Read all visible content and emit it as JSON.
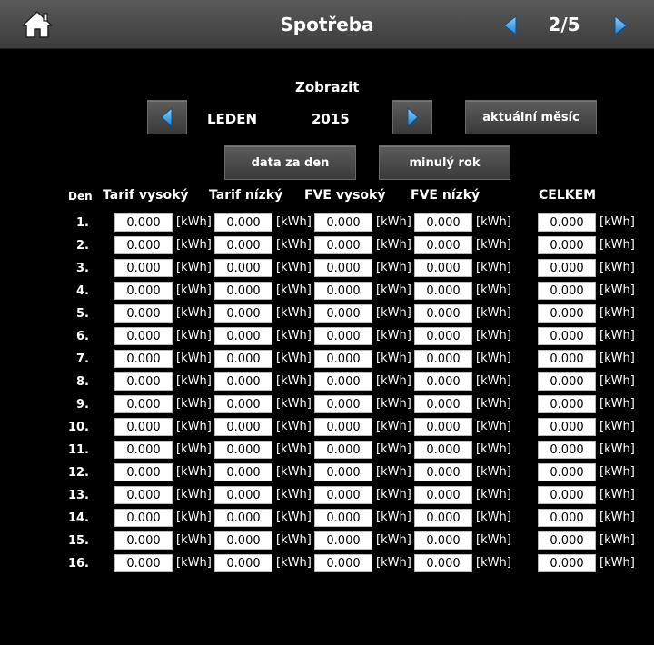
{
  "header": {
    "title": "Spotřeba",
    "page": "2/5"
  },
  "zobrazit": {
    "label": "Zobrazit",
    "month": "LEDEN",
    "year": "2015",
    "current_month_button": "aktuální měsíc",
    "day_data_button": "data za den",
    "last_year_button": "minulý rok"
  },
  "table": {
    "columns": [
      "Den",
      "Tarif vysoký",
      "Tarif nízký",
      "FVE vysoký",
      "FVE nízký",
      "CELKEM"
    ],
    "unit": "[kWh]",
    "rows": [
      {
        "day": "1.",
        "tarif_vysoky": "0.000",
        "tarif_nizky": "0.000",
        "fve_vysoky": "0.000",
        "fve_nizky": "0.000",
        "celkem": "0.000"
      },
      {
        "day": "2.",
        "tarif_vysoky": "0.000",
        "tarif_nizky": "0.000",
        "fve_vysoky": "0.000",
        "fve_nizky": "0.000",
        "celkem": "0.000"
      },
      {
        "day": "3.",
        "tarif_vysoky": "0.000",
        "tarif_nizky": "0.000",
        "fve_vysoky": "0.000",
        "fve_nizky": "0.000",
        "celkem": "0.000"
      },
      {
        "day": "4.",
        "tarif_vysoky": "0.000",
        "tarif_nizky": "0.000",
        "fve_vysoky": "0.000",
        "fve_nizky": "0.000",
        "celkem": "0.000"
      },
      {
        "day": "5.",
        "tarif_vysoky": "0.000",
        "tarif_nizky": "0.000",
        "fve_vysoky": "0.000",
        "fve_nizky": "0.000",
        "celkem": "0.000"
      },
      {
        "day": "6.",
        "tarif_vysoky": "0.000",
        "tarif_nizky": "0.000",
        "fve_vysoky": "0.000",
        "fve_nizky": "0.000",
        "celkem": "0.000"
      },
      {
        "day": "7.",
        "tarif_vysoky": "0.000",
        "tarif_nizky": "0.000",
        "fve_vysoky": "0.000",
        "fve_nizky": "0.000",
        "celkem": "0.000"
      },
      {
        "day": "8.",
        "tarif_vysoky": "0.000",
        "tarif_nizky": "0.000",
        "fve_vysoky": "0.000",
        "fve_nizky": "0.000",
        "celkem": "0.000"
      },
      {
        "day": "9.",
        "tarif_vysoky": "0.000",
        "tarif_nizky": "0.000",
        "fve_vysoky": "0.000",
        "fve_nizky": "0.000",
        "celkem": "0.000"
      },
      {
        "day": "10.",
        "tarif_vysoky": "0.000",
        "tarif_nizky": "0.000",
        "fve_vysoky": "0.000",
        "fve_nizky": "0.000",
        "celkem": "0.000"
      },
      {
        "day": "11.",
        "tarif_vysoky": "0.000",
        "tarif_nizky": "0.000",
        "fve_vysoky": "0.000",
        "fve_nizky": "0.000",
        "celkem": "0.000"
      },
      {
        "day": "12.",
        "tarif_vysoky": "0.000",
        "tarif_nizky": "0.000",
        "fve_vysoky": "0.000",
        "fve_nizky": "0.000",
        "celkem": "0.000"
      },
      {
        "day": "13.",
        "tarif_vysoky": "0.000",
        "tarif_nizky": "0.000",
        "fve_vysoky": "0.000",
        "fve_nizky": "0.000",
        "celkem": "0.000"
      },
      {
        "day": "14.",
        "tarif_vysoky": "0.000",
        "tarif_nizky": "0.000",
        "fve_vysoky": "0.000",
        "fve_nizky": "0.000",
        "celkem": "0.000"
      },
      {
        "day": "15.",
        "tarif_vysoky": "0.000",
        "tarif_nizky": "0.000",
        "fve_vysoky": "0.000",
        "fve_nizky": "0.000",
        "celkem": "0.000"
      },
      {
        "day": "16.",
        "tarif_vysoky": "0.000",
        "tarif_nizky": "0.000",
        "fve_vysoky": "0.000",
        "fve_nizky": "0.000",
        "celkem": "0.000"
      }
    ]
  },
  "icons": {
    "home": "home-icon",
    "prev": "arrow-left-icon",
    "next": "arrow-right-icon"
  },
  "colors": {
    "background": "#000000",
    "header_bar": "#4a4a4a",
    "arrow_blue": "#3aa0e8"
  }
}
